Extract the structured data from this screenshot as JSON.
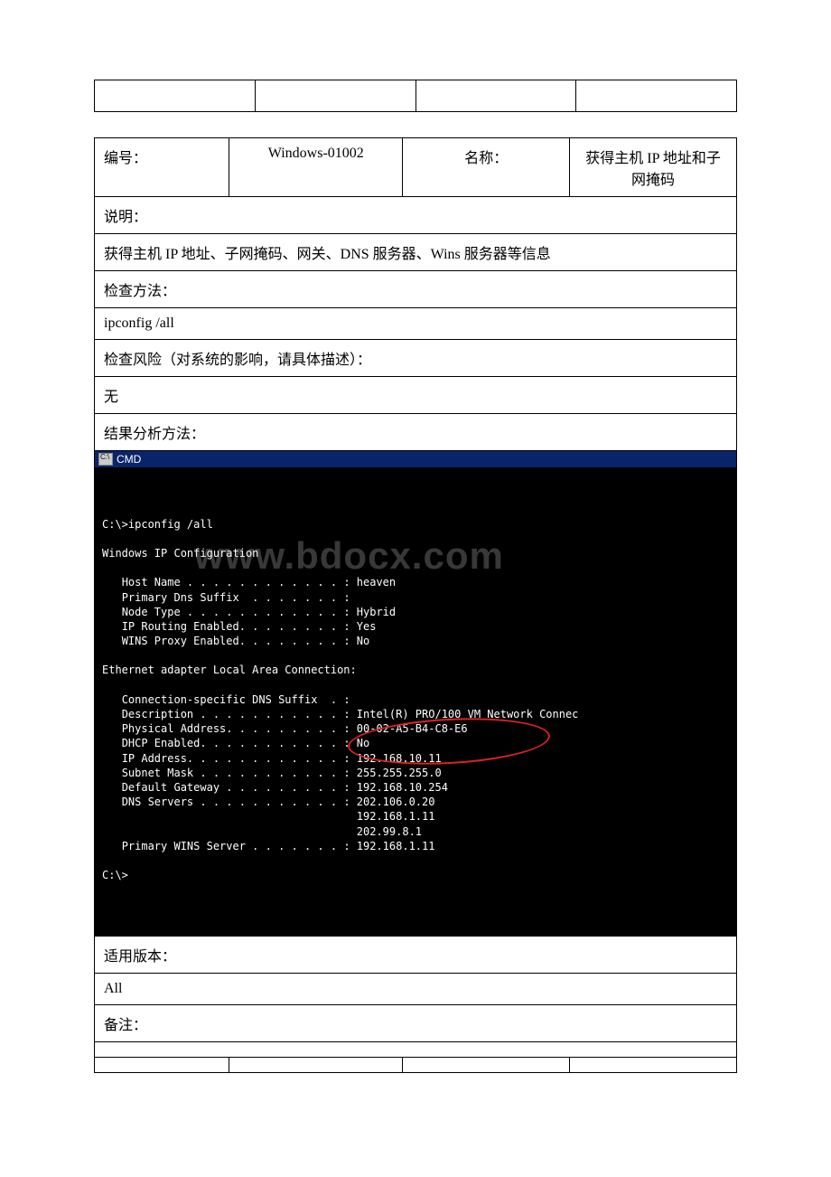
{
  "top_empty": [
    "",
    "",
    "",
    ""
  ],
  "header": {
    "label_id": "编号：",
    "id": "Windows-01002",
    "label_name": "名称：",
    "name": "获得主机 IP 地址和子网掩码"
  },
  "rows": {
    "desc_label": "说明：",
    "desc_text": "获得主机 IP 地址、子网掩码、网关、DNS 服务器、Wins 服务器等信息",
    "method_label": "检查方法：",
    "method_text": "ipconfig /all",
    "risk_label": "检查风险（对系统的影响，请具体描述）：",
    "risk_text": "无",
    "result_label": "结果分析方法：",
    "version_label": "适用版本：",
    "version_text": "All",
    "notes_label": "备注：",
    "notes_text": ""
  },
  "cmd": {
    "title": "CMD",
    "watermark": "www.bdocx.com",
    "lines": [
      "C:\\>ipconfig /all",
      "",
      "Windows IP Configuration",
      "",
      "   Host Name . . . . . . . . . . . . : heaven",
      "   Primary Dns Suffix  . . . . . . . :",
      "   Node Type . . . . . . . . . . . . : Hybrid",
      "   IP Routing Enabled. . . . . . . . : Yes",
      "   WINS Proxy Enabled. . . . . . . . : No",
      "",
      "Ethernet adapter Local Area Connection:",
      "",
      "   Connection-specific DNS Suffix  . :",
      "   Description . . . . . . . . . . . : Intel(R) PRO/100 VM Network Connec",
      "   Physical Address. . . . . . . . . : 00-02-A5-B4-C8-E6",
      "   DHCP Enabled. . . . . . . . . . . : No",
      "   IP Address. . . . . . . . . . . . : 192.168.10.11",
      "   Subnet Mask . . . . . . . . . . . : 255.255.255.0",
      "   Default Gateway . . . . . . . . . : 192.168.10.254",
      "   DNS Servers . . . . . . . . . . . : 202.106.0.20",
      "                                       192.168.1.11",
      "                                       202.99.8.1",
      "   Primary WINS Server . . . . . . . : 192.168.1.11",
      "",
      "C:\\>"
    ]
  },
  "bottom_empty": [
    "",
    "",
    "",
    ""
  ]
}
